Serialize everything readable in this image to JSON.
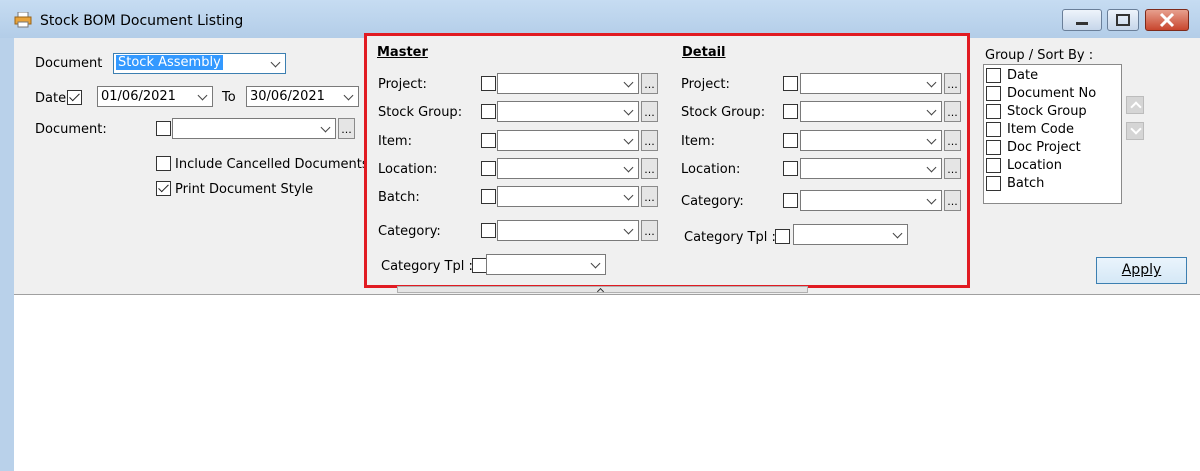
{
  "window": {
    "title": "Stock BOM Document Listing"
  },
  "left": {
    "document_label": "Document",
    "document_value": "Stock Assembly",
    "date_label": "Date",
    "date_from": "01/06/2021",
    "to_label": "To",
    "date_to": "30/06/2021",
    "document2_label": "Document:",
    "document2_value": "",
    "include_cancelled_label": "Include Cancelled Documents",
    "print_document_style_label": "Print Document Style"
  },
  "master": {
    "heading": "Master",
    "project_label": "Project:",
    "stock_group_label": "Stock Group:",
    "item_label": "Item:",
    "location_label": "Location:",
    "batch_label": "Batch:",
    "category_label": "Category:",
    "category_tpl_label": "Category Tpl :"
  },
  "detail": {
    "heading": "Detail",
    "project_label": "Project:",
    "stock_group_label": "Stock Group:",
    "item_label": "Item:",
    "location_label": "Location:",
    "category_label": "Category:",
    "category_tpl_label": "Category Tpl :"
  },
  "group_sort": {
    "label": "Group / Sort By :",
    "items": [
      "Date",
      "Document No",
      "Stock Group",
      "Item Code",
      "Doc Project",
      "Location",
      "Batch"
    ]
  },
  "apply_label": "Apply",
  "ellipsis": "..."
}
